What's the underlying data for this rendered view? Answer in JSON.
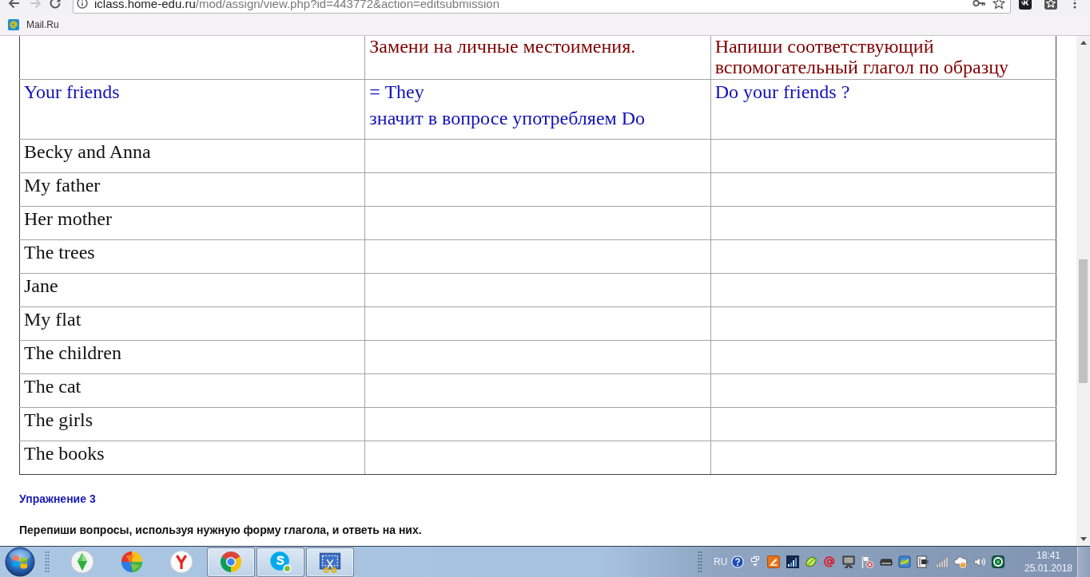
{
  "browser": {
    "forward_disabled": true,
    "address": {
      "host": "iclass.home-edu.ru",
      "path": "/mod/assign/view.php?id=443772&action=editsubmission"
    },
    "bookmarks": [
      {
        "label": "Mail.Ru"
      }
    ]
  },
  "table": {
    "header": {
      "column_2": "Замени на личные местоимения.",
      "column_3": "Напиши соответствующий вспомогательный глагол по образцу"
    },
    "rows": [
      {
        "kind": "example",
        "subject": "Your friends",
        "replacement_lines": [
          "= They",
          "значит в вопросе употребляем Do"
        ],
        "question": "Do your friends ?"
      },
      {
        "kind": "exercise",
        "subject": "Becky and Anna"
      },
      {
        "kind": "exercise",
        "subject": "My father"
      },
      {
        "kind": "exercise",
        "subject": "Her mother"
      },
      {
        "kind": "exercise",
        "subject": "The trees"
      },
      {
        "kind": "exercise",
        "subject": "Jane"
      },
      {
        "kind": "exercise",
        "subject": "My flat"
      },
      {
        "kind": "exercise",
        "subject": "The children"
      },
      {
        "kind": "exercise",
        "subject": "The cat"
      },
      {
        "kind": "exercise",
        "subject": "The girls"
      },
      {
        "kind": "exercise",
        "subject": "The books"
      }
    ]
  },
  "exercise": {
    "title": "Упражнение 3",
    "instruction": "Перепиши вопросы, используя нужную форму глагола, и ответь на них."
  },
  "taskbar": {
    "apps": [
      {
        "kind": "diamond",
        "running": false
      },
      {
        "kind": "ball",
        "running": false
      },
      {
        "kind": "letter",
        "running": false
      },
      {
        "kind": "wheel",
        "running": true
      },
      {
        "kind": "bubble",
        "running": true
      },
      {
        "kind": "scissors",
        "running": true
      }
    ],
    "language": "RU",
    "clock": {
      "time": "18:41",
      "date": "25.01.2018"
    }
  }
}
